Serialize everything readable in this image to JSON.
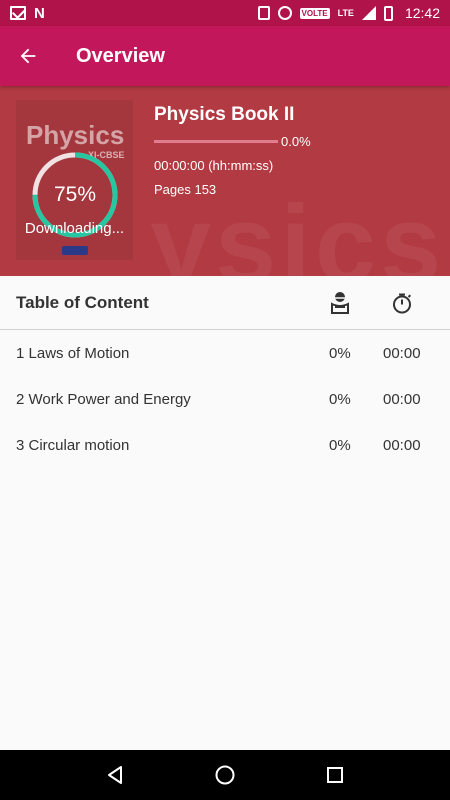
{
  "status_bar": {
    "time": "12:42",
    "volte": "VOLTE",
    "lte": "LTE",
    "icons": [
      "gmail-icon",
      "n-icon",
      "vibrate-icon",
      "alarm-icon",
      "volte-icon",
      "lte-icon",
      "signal-icon",
      "battery-icon"
    ]
  },
  "app_bar": {
    "title": "Overview",
    "back_icon": "arrow-back-icon"
  },
  "book": {
    "cover_title": "Physics",
    "cover_subtitle": "XI-CBSE",
    "download_percent_label": "75%",
    "download_fraction": 0.75,
    "download_status": "Downloading...",
    "title": "Physics Book II",
    "progress_label": "0.0%",
    "progress_fraction": 0.0,
    "time_read": "00:00:00 (hh:mm:ss)",
    "pages": "Pages 153",
    "watermark": "ysics"
  },
  "toc": {
    "title": "Table of Content",
    "reader_icon": "reader-icon",
    "timer_icon": "stopwatch-icon",
    "items": [
      {
        "name": "1 Laws of Motion",
        "percent": "0%",
        "time": "00:00"
      },
      {
        "name": "2 Work Power and Energy",
        "percent": "0%",
        "time": "00:00"
      },
      {
        "name": "3 Circular motion",
        "percent": "0%",
        "time": "00:00"
      }
    ]
  },
  "colors": {
    "status_bar": "#b0134a",
    "app_bar": "#c2185b",
    "header_bg": "#b23a42",
    "ring_accent": "#26c6a0"
  },
  "nav": {
    "back": "nav-back-icon",
    "home": "nav-home-icon",
    "recents": "nav-recents-icon"
  }
}
